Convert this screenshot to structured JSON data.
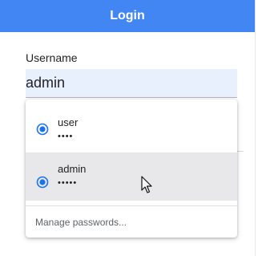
{
  "header": {
    "title": "Login"
  },
  "form": {
    "username_label": "Username",
    "username_value": "admin"
  },
  "autofill": {
    "items": [
      {
        "username": "user",
        "password_mask": "••••",
        "selected": false
      },
      {
        "username": "admin",
        "password_mask": "•••••",
        "selected": true
      }
    ],
    "manage_label": "Manage passwords..."
  },
  "colors": {
    "accent": "#4286f4",
    "autofill_bg": "#e8f0fe",
    "key_icon": "#1a73e8",
    "hover_bg": "#e8e8ea"
  },
  "icons": {
    "credential": "key-icon",
    "pointer": "mouse-pointer-icon"
  }
}
